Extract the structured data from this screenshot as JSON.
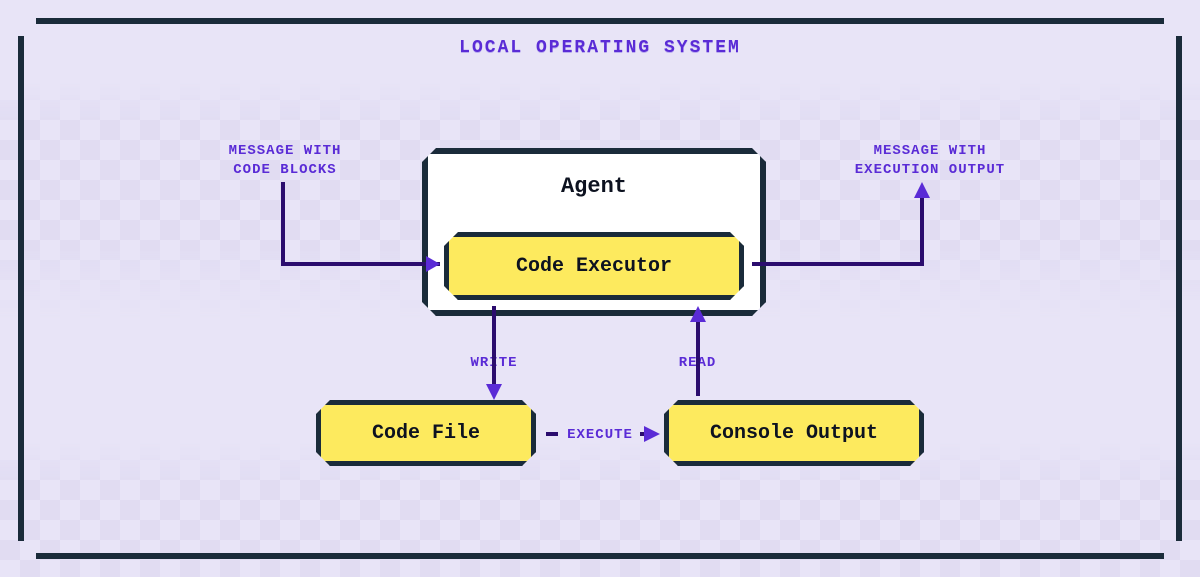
{
  "title": "LOCAL OPERATING SYSTEM",
  "boxes": {
    "agent": "Agent",
    "executor": "Code Executor",
    "codefile": "Code File",
    "console": "Console Output"
  },
  "labels": {
    "msg_in": "MESSAGE WITH\nCODE BLOCKS",
    "msg_out": "MESSAGE WITH\nEXECUTION OUTPUT",
    "write": "WRITE",
    "read": "READ",
    "execute": "EXECUTE"
  }
}
